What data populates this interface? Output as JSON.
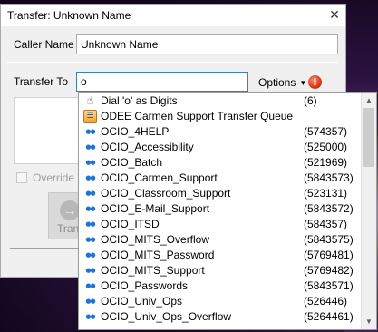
{
  "window": {
    "title": "Transfer: Unknown Name",
    "close_symbol": "✕"
  },
  "caller": {
    "label": "Caller Name",
    "value": "Unknown Name"
  },
  "transfer_to": {
    "label": "Transfer To",
    "value": "o"
  },
  "options": {
    "label": "Options",
    "caret": "▼"
  },
  "warning_icon": {
    "symbol": "!",
    "color": "#d4290d"
  },
  "override": {
    "label": "Override C",
    "checked": false
  },
  "transfer_button": {
    "label": "Trans"
  },
  "dropdown": {
    "items": [
      {
        "icon": "hand-pointer-icon",
        "name": "Dial 'o' as Digits",
        "number": "(6)"
      },
      {
        "icon": "queue-icon",
        "name": "ODEE Carmen Support Transfer Queue",
        "number": ""
      },
      {
        "icon": "people-icon",
        "name": "OCIO_4HELP",
        "number": "(574357)"
      },
      {
        "icon": "people-icon",
        "name": "OCIO_Accessibility",
        "number": "(525000)"
      },
      {
        "icon": "people-icon",
        "name": "OCIO_Batch",
        "number": "(521969)"
      },
      {
        "icon": "people-icon",
        "name": "OCIO_Carmen_Support",
        "number": "(5843573)"
      },
      {
        "icon": "people-icon",
        "name": "OCIO_Classroom_Support",
        "number": "(523131)"
      },
      {
        "icon": "people-icon",
        "name": "OCIO_E-Mail_Support",
        "number": "(5843572)"
      },
      {
        "icon": "people-icon",
        "name": "OCIO_ITSD",
        "number": "(584357)"
      },
      {
        "icon": "people-icon",
        "name": "OCIO_MITS_Overflow",
        "number": "(5843575)"
      },
      {
        "icon": "people-icon",
        "name": "OCIO_MITS_Password",
        "number": "(5769481)"
      },
      {
        "icon": "people-icon",
        "name": "OCIO_MITS_Support",
        "number": "(5769482)"
      },
      {
        "icon": "people-icon",
        "name": "OCIO_Passwords",
        "number": "(5843571)"
      },
      {
        "icon": "people-icon",
        "name": "OCIO_Univ_Ops",
        "number": "(526446)"
      },
      {
        "icon": "people-icon",
        "name": "OCIO_Univ_Ops_Overflow",
        "number": "(5264461)"
      }
    ]
  },
  "scrollbar": {
    "up": "▲",
    "down": "▼"
  }
}
